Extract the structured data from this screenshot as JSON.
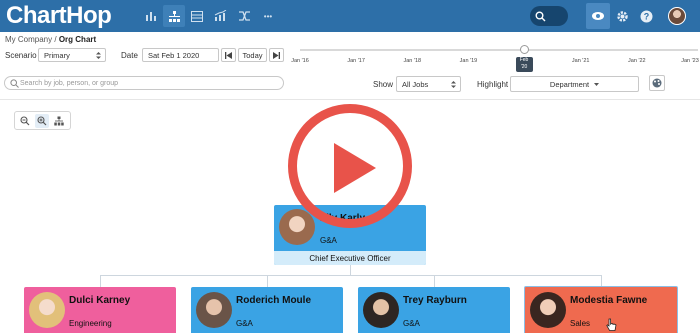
{
  "app": {
    "logo_text": "ChartHop"
  },
  "nav": {
    "icons": [
      "bar-chart-icon",
      "org-chart-icon",
      "table-icon",
      "analytics-icon",
      "shuffle-icon",
      "more-icon"
    ],
    "more_glyph": "•••"
  },
  "breadcrumb": {
    "root": "My Company",
    "separator": "/",
    "current": "Org Chart"
  },
  "controls": {
    "scenario_label": "Scenario",
    "scenario_value": "Primary",
    "date_label": "Date",
    "date_value": "Sat Feb 1 2020",
    "today_label": "Today",
    "show_label": "Show",
    "show_value": "All Jobs",
    "highlight_label": "Highlight",
    "highlight_value": "Department"
  },
  "timeline": {
    "ticks": [
      "Jan '16",
      "Jan '17",
      "Jan '18",
      "Jan '19",
      "Jan '20",
      "Jan '21",
      "Jan '22",
      "Jan '23"
    ],
    "current_tip_line1": "Feb",
    "current_tip_line2": "'20",
    "position_fraction": 0.57
  },
  "search": {
    "placeholder": "Search by job, person, or group"
  },
  "org": {
    "ceo": {
      "name": "Lily Karly",
      "dept": "G&A",
      "title": "Chief Executive Officer"
    },
    "reports": [
      {
        "name": "Dulci Karney",
        "dept": "Engineering",
        "color": "#ef5f9d"
      },
      {
        "name": "Roderich Moule",
        "dept": "G&A",
        "color": "#3aa3e4"
      },
      {
        "name": "Trey Rayburn",
        "dept": "G&A",
        "color": "#3aa3e4"
      },
      {
        "name": "Modestia Fawne",
        "dept": "Sales",
        "color": "#ef6a4f"
      }
    ]
  },
  "colors": {
    "topbar": "#2d6fa8",
    "ga_blue": "#3aa3e4",
    "engineering_pink": "#ef5f9d",
    "sales_orange": "#ef6a4f",
    "play_red": "#e8534a"
  }
}
